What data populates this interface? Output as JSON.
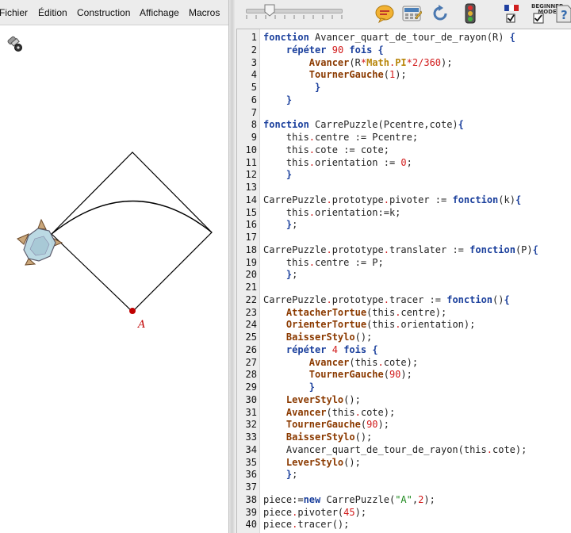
{
  "menu": {
    "items": [
      "Fichier",
      "Édition",
      "Construction",
      "Affichage",
      "Macros"
    ]
  },
  "canvas": {
    "point_label": "A",
    "point_color": "#c00000"
  },
  "toolbar": {
    "icons": [
      "comment-icon",
      "calculator-icon",
      "refresh-icon",
      "traffic-light-icon",
      "flag-fr-icon",
      "beginner-mode-icon",
      "help-icon"
    ],
    "beginner_mode_text": "BEGINNER MODE",
    "slider_level_fraction": 0.2
  },
  "editor": {
    "lines": [
      [
        [
          "kw",
          "fonction"
        ],
        [
          "pl",
          " Avancer_quart_de_tour_de_rayon(R) "
        ],
        [
          "br",
          "{"
        ]
      ],
      [
        [
          "pl",
          "    "
        ],
        [
          "kw",
          "répéter"
        ],
        [
          "pl",
          " "
        ],
        [
          "num",
          "90"
        ],
        [
          "pl",
          " "
        ],
        [
          "kw",
          "fois"
        ],
        [
          "pl",
          " "
        ],
        [
          "br",
          "{"
        ]
      ],
      [
        [
          "pl",
          "        "
        ],
        [
          "fn",
          "Avancer"
        ],
        [
          "pl",
          "(R"
        ],
        [
          "dot",
          "*"
        ],
        [
          "cls",
          "Math"
        ],
        [
          "dot",
          "."
        ],
        [
          "cls",
          "PI"
        ],
        [
          "dot",
          "*"
        ],
        [
          "num",
          "2"
        ],
        [
          "dot",
          "/"
        ],
        [
          "num",
          "360"
        ],
        [
          "pl",
          ");"
        ]
      ],
      [
        [
          "pl",
          "        "
        ],
        [
          "fn",
          "TournerGauche"
        ],
        [
          "pl",
          "("
        ],
        [
          "num",
          "1"
        ],
        [
          "pl",
          ");"
        ]
      ],
      [
        [
          "pl",
          "         "
        ],
        [
          "br",
          "}"
        ]
      ],
      [
        [
          "pl",
          "    "
        ],
        [
          "br",
          "}"
        ]
      ],
      [],
      [
        [
          "kw",
          "fonction"
        ],
        [
          "pl",
          " CarrePuzzle(Pcentre,cote)"
        ],
        [
          "br",
          "{"
        ]
      ],
      [
        [
          "pl",
          "    this"
        ],
        [
          "dot",
          "."
        ],
        [
          "pl",
          "centre := Pcentre;"
        ]
      ],
      [
        [
          "pl",
          "    this"
        ],
        [
          "dot",
          "."
        ],
        [
          "pl",
          "cote := cote;"
        ]
      ],
      [
        [
          "pl",
          "    this"
        ],
        [
          "dot",
          "."
        ],
        [
          "pl",
          "orientation := "
        ],
        [
          "num",
          "0"
        ],
        [
          "pl",
          ";"
        ]
      ],
      [
        [
          "pl",
          "    "
        ],
        [
          "br",
          "}"
        ]
      ],
      [],
      [
        [
          "pl",
          "CarrePuzzle"
        ],
        [
          "dot",
          "."
        ],
        [
          "pl",
          "prototype"
        ],
        [
          "dot",
          "."
        ],
        [
          "pl",
          "pivoter := "
        ],
        [
          "kw",
          "fonction"
        ],
        [
          "pl",
          "(k)"
        ],
        [
          "br",
          "{"
        ]
      ],
      [
        [
          "pl",
          "    this"
        ],
        [
          "dot",
          "."
        ],
        [
          "pl",
          "orientation:=k;"
        ]
      ],
      [
        [
          "pl",
          "    "
        ],
        [
          "br",
          "}"
        ],
        [
          "pl",
          ";"
        ]
      ],
      [],
      [
        [
          "pl",
          "CarrePuzzle"
        ],
        [
          "dot",
          "."
        ],
        [
          "pl",
          "prototype"
        ],
        [
          "dot",
          "."
        ],
        [
          "pl",
          "translater := "
        ],
        [
          "kw",
          "fonction"
        ],
        [
          "pl",
          "(P)"
        ],
        [
          "br",
          "{"
        ]
      ],
      [
        [
          "pl",
          "    this"
        ],
        [
          "dot",
          "."
        ],
        [
          "pl",
          "centre := P;"
        ]
      ],
      [
        [
          "pl",
          "    "
        ],
        [
          "br",
          "}"
        ],
        [
          "pl",
          ";"
        ]
      ],
      [],
      [
        [
          "pl",
          "CarrePuzzle"
        ],
        [
          "dot",
          "."
        ],
        [
          "pl",
          "prototype"
        ],
        [
          "dot",
          "."
        ],
        [
          "pl",
          "tracer := "
        ],
        [
          "kw",
          "fonction"
        ],
        [
          "pl",
          "()"
        ],
        [
          "br",
          "{"
        ]
      ],
      [
        [
          "pl",
          "    "
        ],
        [
          "fn",
          "AttacherTortue"
        ],
        [
          "pl",
          "(this"
        ],
        [
          "dot",
          "."
        ],
        [
          "pl",
          "centre);"
        ]
      ],
      [
        [
          "pl",
          "    "
        ],
        [
          "fn",
          "OrienterTortue"
        ],
        [
          "pl",
          "(this"
        ],
        [
          "dot",
          "."
        ],
        [
          "pl",
          "orientation);"
        ]
      ],
      [
        [
          "pl",
          "    "
        ],
        [
          "fn",
          "BaisserStylo"
        ],
        [
          "pl",
          "();"
        ]
      ],
      [
        [
          "pl",
          "    "
        ],
        [
          "kw",
          "répéter"
        ],
        [
          "pl",
          " "
        ],
        [
          "num",
          "4"
        ],
        [
          "pl",
          " "
        ],
        [
          "kw",
          "fois"
        ],
        [
          "pl",
          " "
        ],
        [
          "br",
          "{"
        ]
      ],
      [
        [
          "pl",
          "        "
        ],
        [
          "fn",
          "Avancer"
        ],
        [
          "pl",
          "(this"
        ],
        [
          "dot",
          "."
        ],
        [
          "pl",
          "cote);"
        ]
      ],
      [
        [
          "pl",
          "        "
        ],
        [
          "fn",
          "TournerGauche"
        ],
        [
          "pl",
          "("
        ],
        [
          "num",
          "90"
        ],
        [
          "pl",
          ");"
        ]
      ],
      [
        [
          "pl",
          "        "
        ],
        [
          "br",
          "}"
        ]
      ],
      [
        [
          "pl",
          "    "
        ],
        [
          "fn",
          "LeverStylo"
        ],
        [
          "pl",
          "();"
        ]
      ],
      [
        [
          "pl",
          "    "
        ],
        [
          "fn",
          "Avancer"
        ],
        [
          "pl",
          "(this"
        ],
        [
          "dot",
          "."
        ],
        [
          "pl",
          "cote);"
        ]
      ],
      [
        [
          "pl",
          "    "
        ],
        [
          "fn",
          "TournerGauche"
        ],
        [
          "pl",
          "("
        ],
        [
          "num",
          "90"
        ],
        [
          "pl",
          ");"
        ]
      ],
      [
        [
          "pl",
          "    "
        ],
        [
          "fn",
          "BaisserStylo"
        ],
        [
          "pl",
          "();"
        ]
      ],
      [
        [
          "pl",
          "    Avancer_quart_de_tour_de_rayon(this"
        ],
        [
          "dot",
          "."
        ],
        [
          "pl",
          "cote);"
        ]
      ],
      [
        [
          "pl",
          "    "
        ],
        [
          "fn",
          "LeverStylo"
        ],
        [
          "pl",
          "();"
        ]
      ],
      [
        [
          "pl",
          "    "
        ],
        [
          "br",
          "}"
        ],
        [
          "pl",
          ";"
        ]
      ],
      [],
      [
        [
          "pl",
          "piece:="
        ],
        [
          "kw",
          "new"
        ],
        [
          "pl",
          " CarrePuzzle("
        ],
        [
          "str",
          "\"A\""
        ],
        [
          "pl",
          ","
        ],
        [
          "num",
          "2"
        ],
        [
          "pl",
          ");"
        ]
      ],
      [
        [
          "pl",
          "piece"
        ],
        [
          "dot",
          "."
        ],
        [
          "pl",
          "pivoter("
        ],
        [
          "num",
          "45"
        ],
        [
          "pl",
          ");"
        ]
      ],
      [
        [
          "pl",
          "piece"
        ],
        [
          "dot",
          "."
        ],
        [
          "pl",
          "tracer();"
        ]
      ]
    ]
  }
}
